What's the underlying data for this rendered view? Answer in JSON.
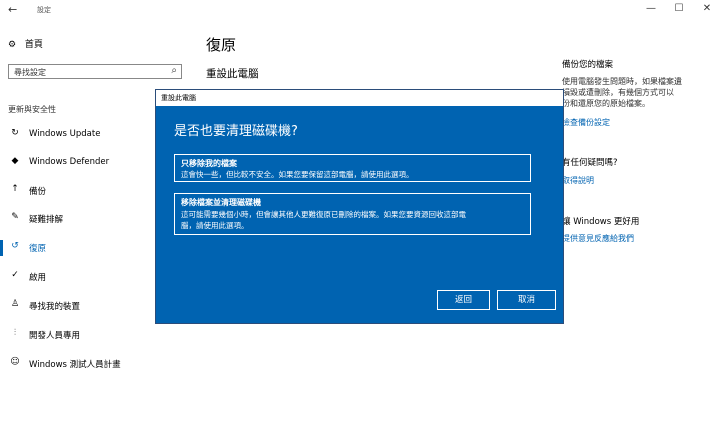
{
  "window": {
    "back_glyph": "←",
    "title": "設定",
    "minimize": "—",
    "maximize": "☐",
    "close": "✕"
  },
  "sidebar": {
    "home": {
      "icon": "gear-icon",
      "label": "首頁"
    },
    "search": {
      "placeholder": "尋找設定",
      "icon": "search-icon"
    },
    "section": "更新與安全性",
    "items": [
      {
        "label": "Windows Update",
        "icon": "refresh-icon",
        "glyph": "↻"
      },
      {
        "label": "Windows Defender",
        "icon": "shield-icon",
        "glyph": "◆"
      },
      {
        "label": "備份",
        "icon": "backup-icon",
        "glyph": "↑"
      },
      {
        "label": "疑難排解",
        "icon": "wrench-icon",
        "glyph": "✎"
      },
      {
        "label": "復原",
        "icon": "history-icon",
        "glyph": "↺",
        "active": true
      },
      {
        "label": "啟用",
        "icon": "check-circle-icon",
        "glyph": "✓"
      },
      {
        "label": "尋找我的裝置",
        "icon": "person-icon",
        "glyph": "♙"
      },
      {
        "label": "開發人員專用",
        "icon": "developer-icon",
        "glyph": "⫶"
      },
      {
        "label": "Windows 測試人員計畫",
        "icon": "insider-icon",
        "glyph": "☺"
      }
    ]
  },
  "main": {
    "title": "復原",
    "subtitle": "重設此電腦"
  },
  "right": {
    "backup_heading": "備份您的檔案",
    "backup_text": [
      "使用電腦發生問題時，如果檔案遺",
      "損毀或遭刪除，有幾個方式可以",
      "份和還原您的原始檔案。"
    ],
    "backup_link": "檢查備份設定",
    "question_heading": "有任何疑問嗎?",
    "question_link": "取得說明",
    "feedback_heading": "讓 Windows 更好用",
    "feedback_link": "提供意見反應給我們"
  },
  "dialog": {
    "title": "重設此電腦",
    "heading": "是否也要清理磁碟機?",
    "option1": {
      "title": "只移除我的檔案",
      "desc": [
        "這會快一些，但比較不安全。如果您要保留這部電腦，請使用此選項。"
      ]
    },
    "option2": {
      "title": "移除檔案並清理磁碟機",
      "desc": [
        "這可能需要幾個小時，但會讓其他人更難復原已刪除的檔案。如果您要資源回收這部電",
        "腦，請使用此選項。"
      ]
    },
    "back_button": "返回",
    "cancel_button": "取消"
  }
}
